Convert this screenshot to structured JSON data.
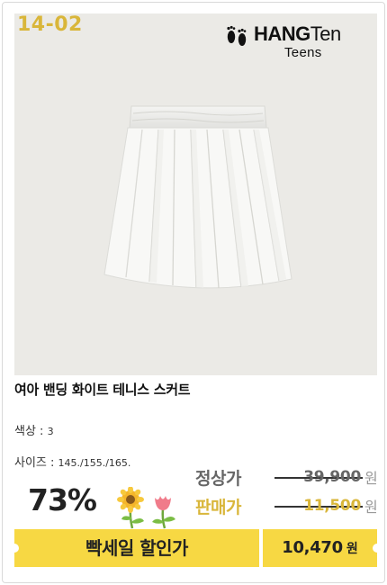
{
  "product": {
    "code": "14-02",
    "brand_main_bold": "HANG",
    "brand_main_thin": "Ten",
    "brand_sub": "Teens",
    "title": "여아 밴딩 화이트 테니스 스커트",
    "color_label": "색상 : ",
    "color_value": "3",
    "size_label": "사이즈 : ",
    "size_value": "145./155./165."
  },
  "pricing": {
    "discount_percent": "73%",
    "regular_label": "정상가",
    "regular_price": "39,900",
    "regular_unit": "원",
    "sale_label": "판매가",
    "sale_price": "11,500",
    "sale_unit": "원"
  },
  "banner": {
    "event_label": "빡세일 할인가",
    "final_price": "10,470",
    "final_unit": "원"
  },
  "colors": {
    "accent_yellow": "#f7d843",
    "gold_text": "#d9b63a",
    "photo_bg": "#ebeae6"
  }
}
